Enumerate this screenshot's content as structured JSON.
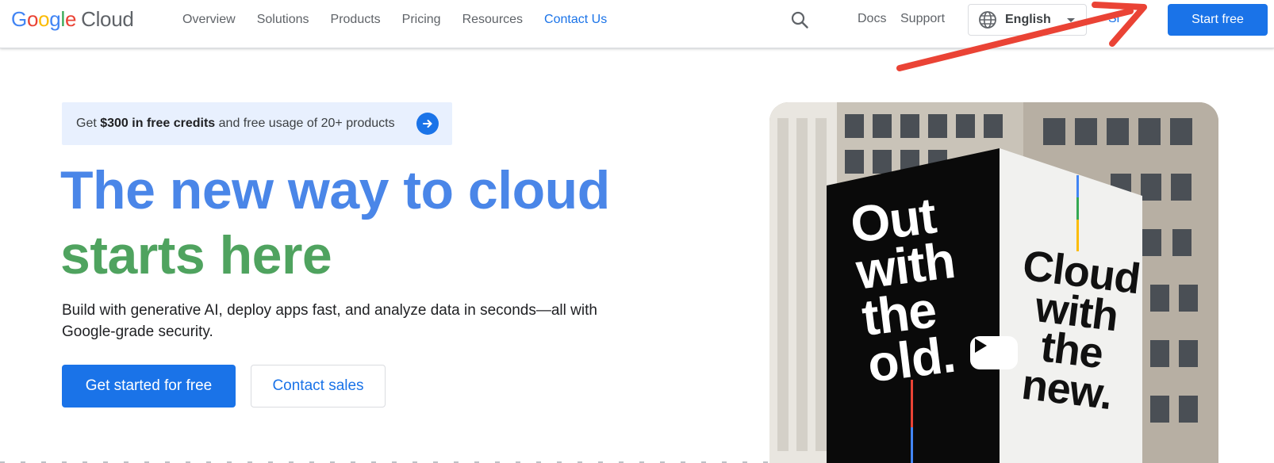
{
  "brand": {
    "logo_letters": [
      "G",
      "o",
      "o",
      "g",
      "l",
      "e"
    ],
    "product": "Cloud",
    "colors": {
      "blue": "#4285F4",
      "red": "#EA4335",
      "yellow": "#FBBC05",
      "green": "#34A853"
    }
  },
  "nav": {
    "items": [
      {
        "label": "Overview"
      },
      {
        "label": "Solutions"
      },
      {
        "label": "Products"
      },
      {
        "label": "Pricing"
      },
      {
        "label": "Resources"
      },
      {
        "label": "Contact Us"
      }
    ],
    "active_index": 5
  },
  "header": {
    "search_icon": "search-icon",
    "docs_label": "Docs",
    "support_label": "Support",
    "language": {
      "icon": "globe-icon",
      "selected": "English"
    },
    "signin_label": "Si",
    "start_free_label": "Start free",
    "accent_color": "#1a73e8"
  },
  "annotation": {
    "icon": "red-arrow-icon",
    "color": "#EA4335"
  },
  "promo": {
    "prefix": "Get ",
    "highlight": "$300 in free credits",
    "suffix": " and free usage of 20+ products",
    "icon": "arrow-right-icon"
  },
  "hero": {
    "headline_line1": "The new way to cloud",
    "headline_line2": "starts here",
    "headline_colors": {
      "line1": "#4a86e8",
      "line2": "#4fa35f"
    },
    "subtext": "Build with generative AI, deploy apps fast, and analyze data in seconds—all with Google-grade security.",
    "primary_cta": "Get started for free",
    "secondary_cta": "Contact sales"
  },
  "video": {
    "billboard_left": [
      "Out",
      "with",
      "the",
      "old."
    ],
    "billboard_right": [
      "Cloud",
      "with",
      "the",
      "new."
    ],
    "play_icon": "play-icon"
  }
}
